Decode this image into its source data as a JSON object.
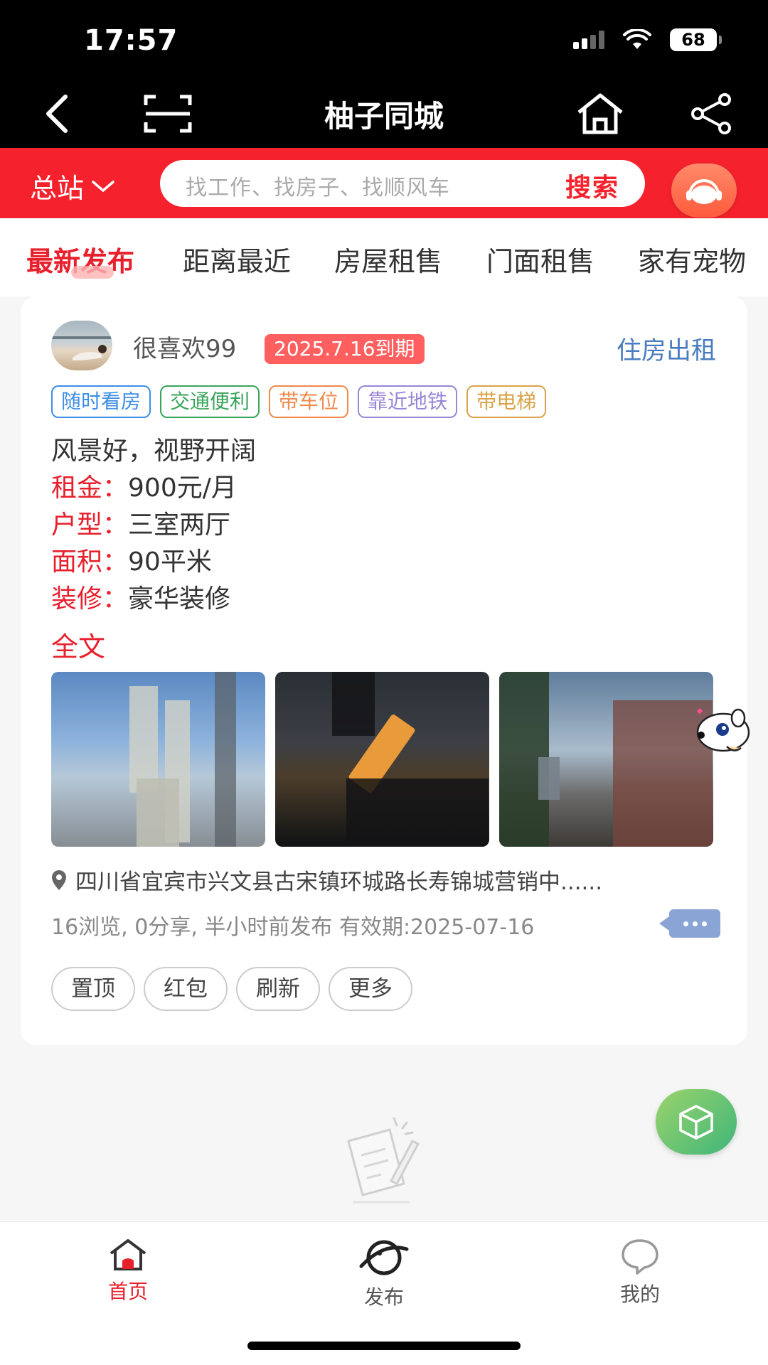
{
  "status_bar": {
    "time": "17:57",
    "battery": "68"
  },
  "header": {
    "title": "柚子同城"
  },
  "search": {
    "station": "总站",
    "placeholder": "找工作、找房子、找顺风车",
    "button": "搜索"
  },
  "tabs": [
    {
      "label": "最新发布",
      "active": true
    },
    {
      "label": "距离最近",
      "active": false
    },
    {
      "label": "房屋租售",
      "active": false
    },
    {
      "label": "门面租售",
      "active": false
    },
    {
      "label": "家有宠物",
      "active": false
    }
  ],
  "post": {
    "username": "很喜欢99",
    "expire_badge": "2025.7.16到期",
    "category": "住房出租",
    "tags": [
      "随时看房",
      "交通便利",
      "带车位",
      "靠近地铁",
      "带电梯"
    ],
    "description": "风景好，视野开阔",
    "fields": [
      {
        "label": "租金：",
        "value": "900元/月"
      },
      {
        "label": "户型：",
        "value": "三室两厅"
      },
      {
        "label": "面积：",
        "value": "90平米"
      },
      {
        "label": "装修：",
        "value": "豪华装修"
      }
    ],
    "full_text_link": "全文",
    "location": "四川省宜宾市兴文县古宋镇环城路长寿锦城营销中......",
    "meta": "16浏览, 0分享, 半小时前发布 有效期:2025-07-16",
    "actions": [
      "置顶",
      "红包",
      "刷新",
      "更多"
    ]
  },
  "bottom_nav": [
    {
      "label": "首页",
      "icon": "home-icon",
      "active": true
    },
    {
      "label": "发布",
      "icon": "planet-icon",
      "active": false
    },
    {
      "label": "我的",
      "icon": "chat-bubble-icon",
      "active": false
    }
  ],
  "colors": {
    "brand_red": "#f5222d",
    "accent_blue": "#4a7dbf"
  }
}
